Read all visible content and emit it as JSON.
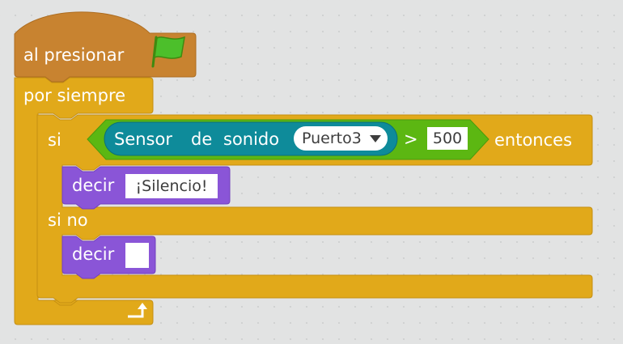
{
  "script": {
    "hat": {
      "label": "al presionar",
      "icon": "green-flag-icon",
      "color": "#c88330"
    },
    "forever": {
      "label": "por siempre",
      "icon": "loop-arrow-icon",
      "color": "#e1a91a"
    },
    "ifelse": {
      "if_label": "si",
      "then_label": "entonces",
      "else_label": "si no",
      "condition": {
        "operator": ">",
        "value": "500",
        "color": "#5cb712",
        "sensor": {
          "label_parts": [
            "Sensor",
            "de",
            "sonido"
          ],
          "port": "Puerto3",
          "color": "#0e8b9a"
        }
      }
    },
    "say_if": {
      "label": "decir",
      "value": "¡Silencio!",
      "color": "#8a55d7"
    },
    "say_else": {
      "label": "decir",
      "value": ""
    }
  }
}
